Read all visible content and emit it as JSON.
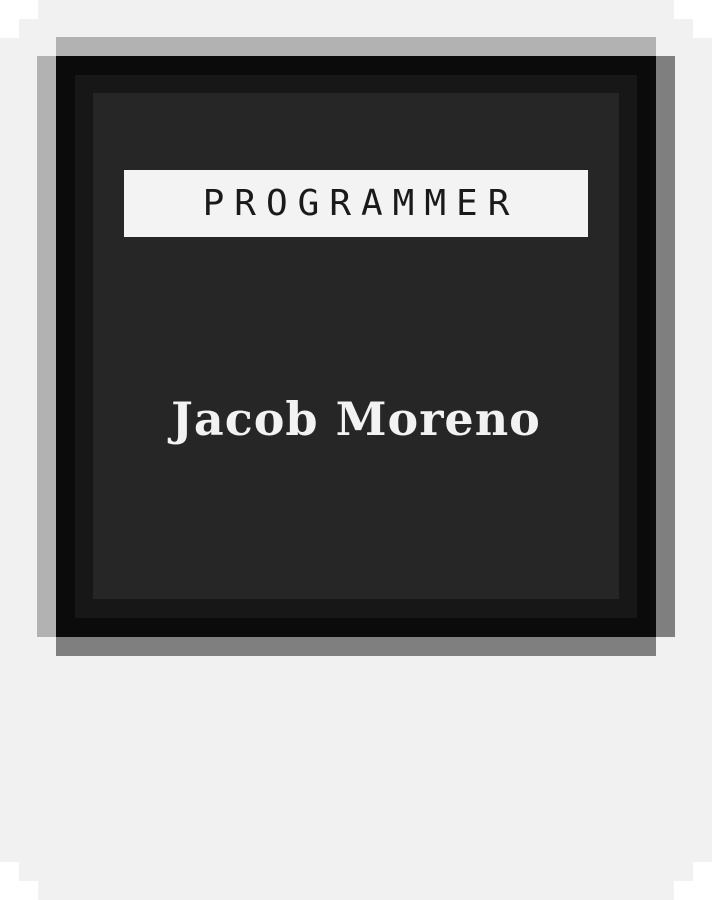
{
  "card": {
    "role": "PROGRAMMER",
    "name": "Jacob Moreno"
  }
}
